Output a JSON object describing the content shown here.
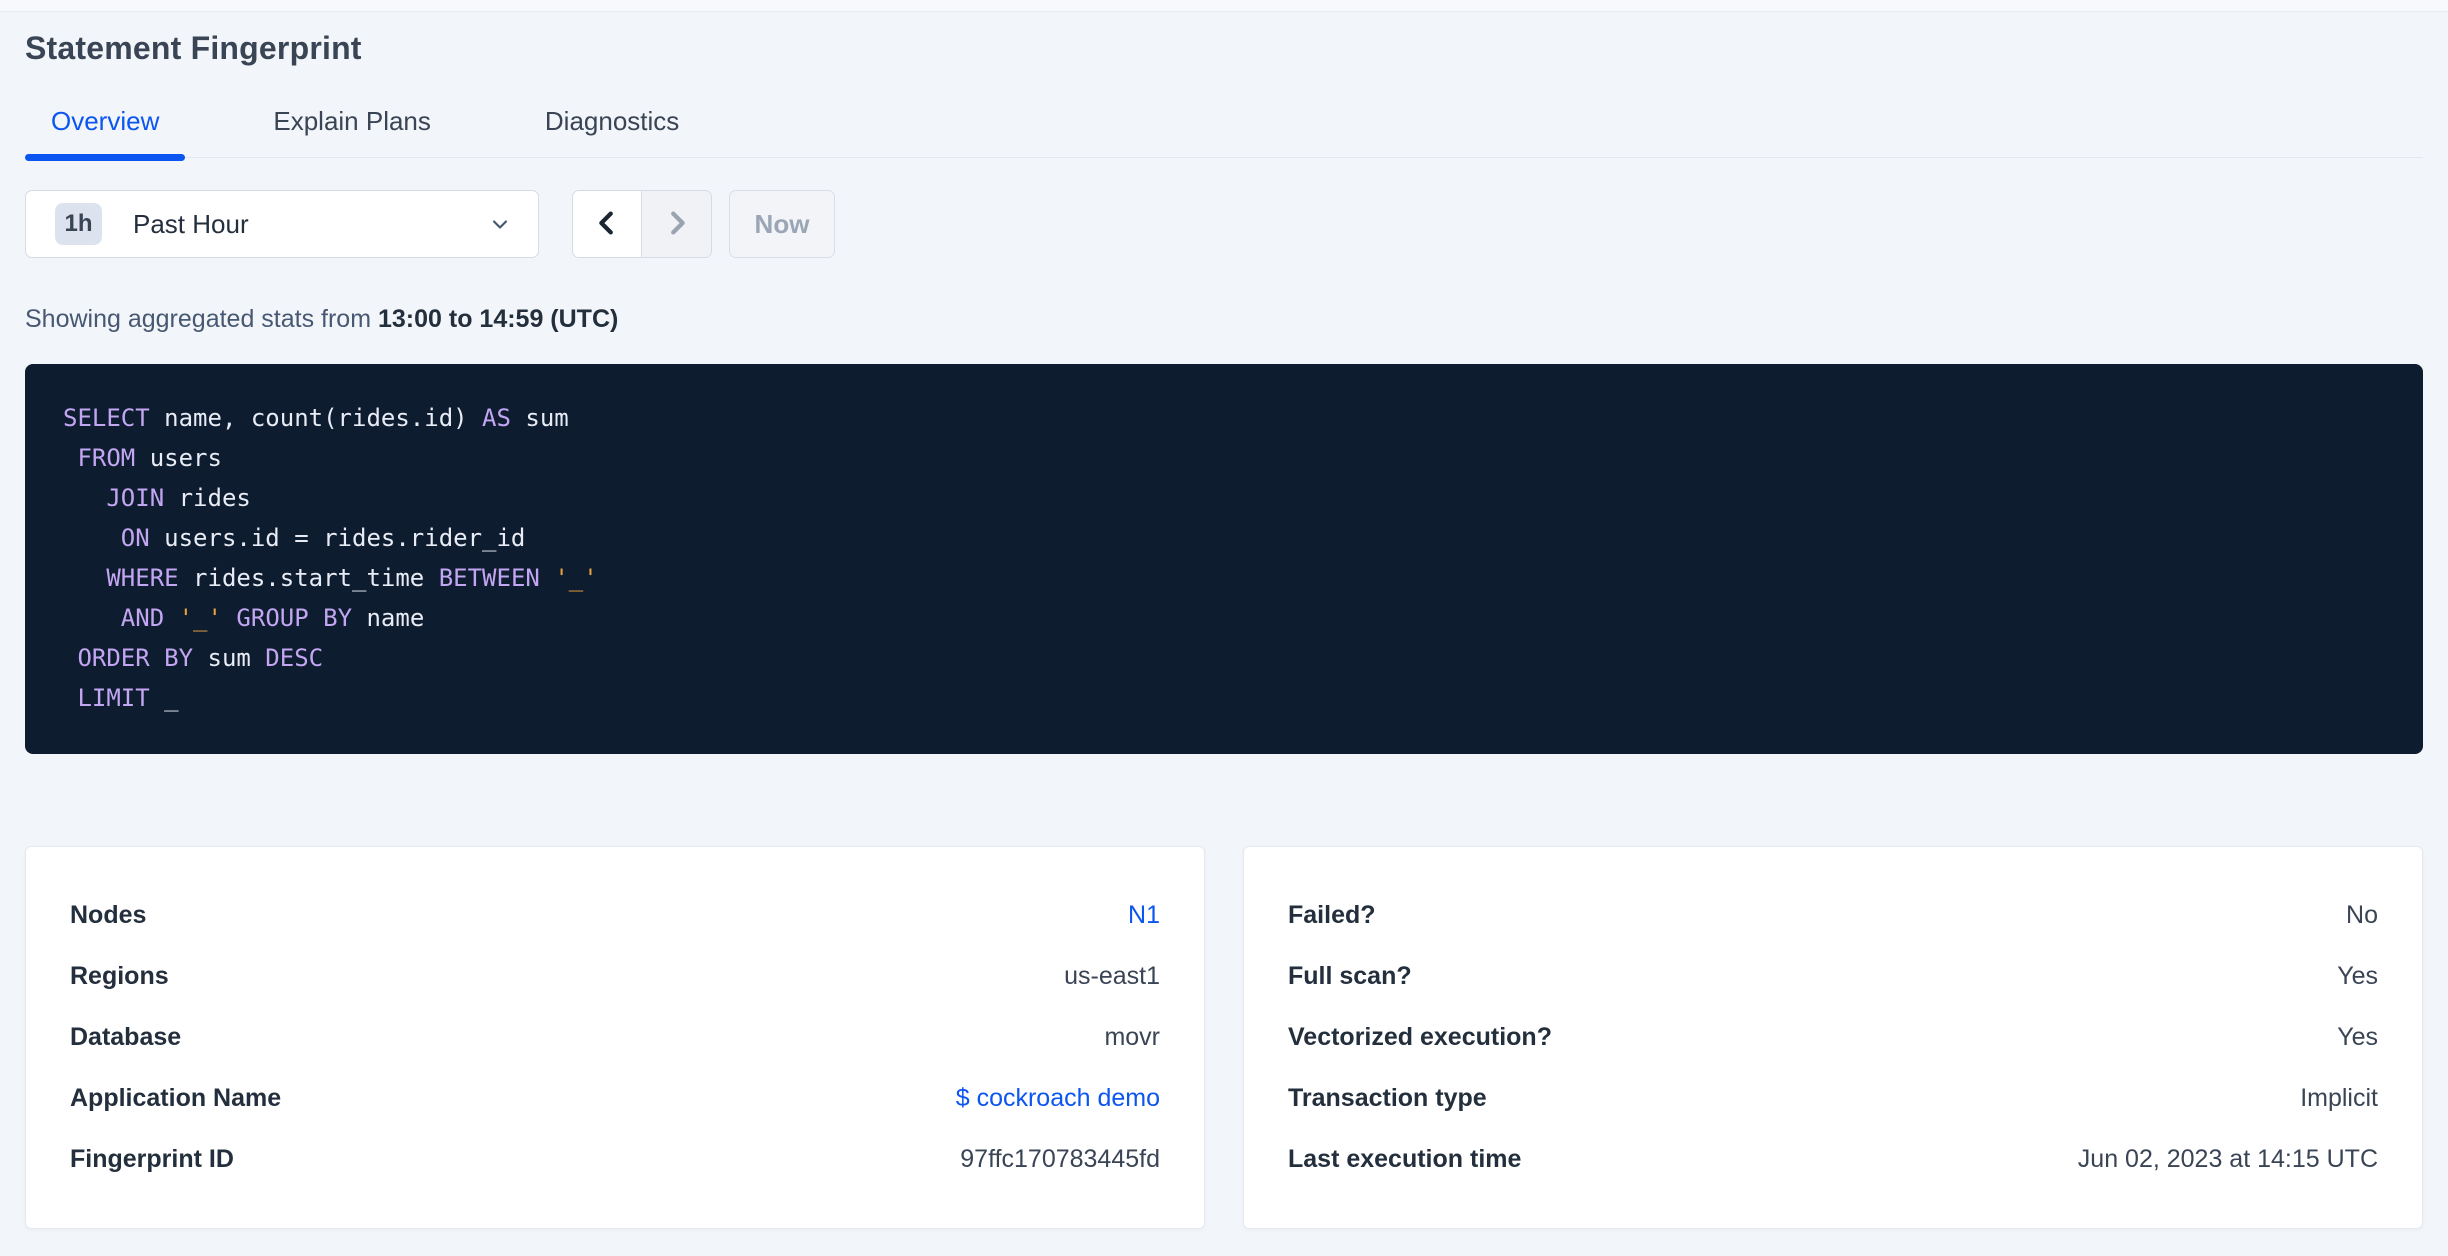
{
  "page": {
    "title": "Statement Fingerprint"
  },
  "tabs": [
    {
      "label": "Overview",
      "active": true
    },
    {
      "label": "Explain Plans",
      "active": false
    },
    {
      "label": "Diagnostics",
      "active": false
    }
  ],
  "time_picker": {
    "badge": "1h",
    "selected_label": "Past Hour",
    "now_label": "Now",
    "prev_icon": "chevron-left",
    "next_icon": "chevron-right",
    "open_icon": "chevron-down"
  },
  "stats_line": {
    "prefix": "Showing aggregated stats from ",
    "bold_range": "13:00 to 14:59 (UTC)"
  },
  "sql": {
    "lines": [
      [
        {
          "t": "SELECT",
          "c": "kw"
        },
        {
          "t": " name, count(rides.id) "
        },
        {
          "t": "AS",
          "c": "kw"
        },
        {
          "t": " sum"
        }
      ],
      [
        {
          "t": " "
        },
        {
          "t": "FROM",
          "c": "kw"
        },
        {
          "t": " users"
        }
      ],
      [
        {
          "t": "   "
        },
        {
          "t": "JOIN",
          "c": "kw"
        },
        {
          "t": " rides"
        }
      ],
      [
        {
          "t": "    "
        },
        {
          "t": "ON",
          "c": "kw"
        },
        {
          "t": " users.id = rides.rider_id"
        }
      ],
      [
        {
          "t": "   "
        },
        {
          "t": "WHERE",
          "c": "kw"
        },
        {
          "t": " rides.start_time "
        },
        {
          "t": "BETWEEN",
          "c": "kw"
        },
        {
          "t": " "
        },
        {
          "t": "'_'",
          "c": "str"
        }
      ],
      [
        {
          "t": "    "
        },
        {
          "t": "AND",
          "c": "kw"
        },
        {
          "t": " "
        },
        {
          "t": "'_'",
          "c": "str"
        },
        {
          "t": " "
        },
        {
          "t": "GROUP BY",
          "c": "kw"
        },
        {
          "t": " name"
        }
      ],
      [
        {
          "t": " "
        },
        {
          "t": "ORDER BY",
          "c": "kw"
        },
        {
          "t": " sum "
        },
        {
          "t": "DESC",
          "c": "kw"
        }
      ],
      [
        {
          "t": " "
        },
        {
          "t": "LIMIT",
          "c": "kw"
        },
        {
          "t": " _"
        }
      ]
    ]
  },
  "cards": [
    {
      "rows": [
        {
          "label": "Nodes",
          "value": "N1",
          "link": true
        },
        {
          "label": "Regions",
          "value": "us-east1",
          "link": false
        },
        {
          "label": "Database",
          "value": "movr",
          "link": false
        },
        {
          "label": "Application Name",
          "value": "$ cockroach demo",
          "link": true
        },
        {
          "label": "Fingerprint ID",
          "value": "97ffc170783445fd",
          "link": false
        }
      ]
    },
    {
      "rows": [
        {
          "label": "Failed?",
          "value": "No",
          "link": false
        },
        {
          "label": "Full scan?",
          "value": "Yes",
          "link": false
        },
        {
          "label": "Vectorized execution?",
          "value": "Yes",
          "link": false
        },
        {
          "label": "Transaction type",
          "value": "Implicit",
          "link": false
        },
        {
          "label": "Last execution time",
          "value": "Jun 02, 2023 at 14:15 UTC",
          "link": false
        }
      ]
    }
  ],
  "colors": {
    "accent_blue": "#0b55f0",
    "page_background": "#f2f5f9",
    "sql_background": "#0e1c30",
    "sql_keyword": "#c3a6f2",
    "sql_string": "#e8a23e",
    "sql_text": "#e8ecf5",
    "label_dark": "#242f3d",
    "text_mid": "#394455",
    "disabled_text": "#9aa5b5"
  }
}
